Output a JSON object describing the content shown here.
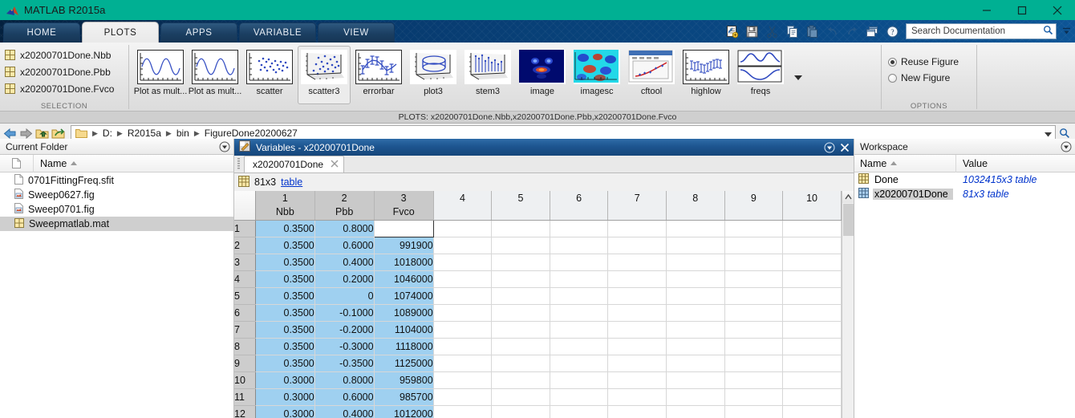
{
  "window": {
    "title": "MATLAB R2015a"
  },
  "tabs": [
    {
      "label": "HOME",
      "active": false
    },
    {
      "label": "PLOTS",
      "active": true
    },
    {
      "label": "APPS",
      "active": false
    },
    {
      "label": "VARIABLE",
      "active": false
    },
    {
      "label": "VIEW",
      "active": false
    }
  ],
  "quickbar": {
    "icons": [
      "new-script-icon",
      "save-icon",
      "cut-icon",
      "copy-icon",
      "paste-icon",
      "undo-icon",
      "redo-icon",
      "layout-icon",
      "help-icon"
    ],
    "search": {
      "placeholder": "Search Documentation",
      "value": ""
    },
    "collapse": "collapse-ribbon-icon"
  },
  "ribbon": {
    "selection": {
      "label": "SELECTION",
      "items": [
        {
          "label": "x20200701Done.Nbb",
          "icon": "table-variable-icon"
        },
        {
          "label": "x20200701Done.Pbb",
          "icon": "table-variable-icon"
        },
        {
          "label": "x20200701Done.Fvco",
          "icon": "table-variable-icon"
        }
      ]
    },
    "gallery": {
      "items": [
        {
          "label": "Plot as mult...",
          "kind": "sine",
          "selected": false
        },
        {
          "label": "Plot as mult...",
          "kind": "sine",
          "selected": false
        },
        {
          "label": "scatter",
          "kind": "scatter",
          "selected": false
        },
        {
          "label": "scatter3",
          "kind": "scatter3",
          "selected": true
        },
        {
          "label": "errorbar",
          "kind": "errorbar",
          "selected": false
        },
        {
          "label": "plot3",
          "kind": "plot3",
          "selected": false
        },
        {
          "label": "stem3",
          "kind": "stem3",
          "selected": false
        },
        {
          "label": "image",
          "kind": "image",
          "selected": false
        },
        {
          "label": "imagesc",
          "kind": "imagesc",
          "selected": false
        },
        {
          "label": "cftool",
          "kind": "cftool",
          "selected": false
        },
        {
          "label": "highlow",
          "kind": "highlow",
          "selected": false
        },
        {
          "label": "freqs",
          "kind": "freqs",
          "selected": false
        }
      ],
      "more": "gallery-more-icon"
    },
    "options": {
      "label": "OPTIONS",
      "choices": [
        {
          "label": "Reuse Figure",
          "selected": true
        },
        {
          "label": "New Figure",
          "selected": false
        }
      ]
    },
    "status": "PLOTS: x20200701Done.Nbb,x20200701Done.Pbb,x20200701Done.Fvco"
  },
  "address": {
    "nav": [
      "back-icon",
      "forward-icon",
      "up-folder-icon",
      "browse-folder-icon"
    ],
    "crumbs": [
      "D:",
      "R2015a",
      "bin",
      "FigureDone20200627"
    ],
    "dropdown": "chevron-down-icon",
    "search": "search-icon"
  },
  "current_folder": {
    "title": "Current Folder",
    "menu": "panel-menu-icon",
    "columns": [
      "",
      "Name"
    ],
    "sort": "ascending",
    "files": [
      {
        "name": "0701FittingFreq.sfit",
        "icon": "file-icon",
        "selected": false
      },
      {
        "name": "Sweep0627.fig",
        "icon": "figure-icon",
        "selected": false
      },
      {
        "name": "Sweep0701.fig",
        "icon": "figure-icon",
        "selected": false
      },
      {
        "name": "Sweepmatlab.mat",
        "icon": "mat-file-icon",
        "selected": true
      }
    ]
  },
  "variables": {
    "title": "Variables - x20200701Done",
    "title_icon": "variables-icon",
    "menu": "panel-menu-icon",
    "close": "close-icon",
    "tab": {
      "label": "x20200701Done",
      "close": "tab-close-icon"
    },
    "info": {
      "icon": "table-icon",
      "size": "81x3",
      "type": "table"
    },
    "table": {
      "col_numbers": [
        "1",
        "2",
        "3",
        "4",
        "5",
        "6",
        "7",
        "8",
        "9",
        "10"
      ],
      "col_names": [
        "Nbb",
        "Pbb",
        "Fvco",
        "",
        "",
        "",
        "",
        "",
        "",
        ""
      ],
      "rows": [
        {
          "n": "1",
          "cells": [
            "0.3500",
            "0.8000",
            ""
          ]
        },
        {
          "n": "2",
          "cells": [
            "0.3500",
            "0.6000",
            "991900"
          ]
        },
        {
          "n": "3",
          "cells": [
            "0.3500",
            "0.4000",
            "1018000"
          ]
        },
        {
          "n": "4",
          "cells": [
            "0.3500",
            "0.2000",
            "1046000"
          ]
        },
        {
          "n": "5",
          "cells": [
            "0.3500",
            "0",
            "1074000"
          ]
        },
        {
          "n": "6",
          "cells": [
            "0.3500",
            "-0.1000",
            "1089000"
          ]
        },
        {
          "n": "7",
          "cells": [
            "0.3500",
            "-0.2000",
            "1104000"
          ]
        },
        {
          "n": "8",
          "cells": [
            "0.3500",
            "-0.3000",
            "1118000"
          ]
        },
        {
          "n": "9",
          "cells": [
            "0.3500",
            "-0.3500",
            "1125000"
          ]
        },
        {
          "n": "10",
          "cells": [
            "0.3000",
            "0.8000",
            "959800"
          ]
        },
        {
          "n": "11",
          "cells": [
            "0.3000",
            "0.6000",
            "985700"
          ]
        },
        {
          "n": "12",
          "cells": [
            "0.3000",
            "0.4000",
            "1012000"
          ]
        }
      ],
      "editing_cell": {
        "row": 1,
        "col": 3
      }
    },
    "scrollbar": {
      "up": "scroll-up-icon"
    }
  },
  "workspace": {
    "title": "Workspace",
    "menu": "panel-menu-icon",
    "columns": [
      "Name",
      "Value"
    ],
    "sort": "ascending",
    "rows": [
      {
        "name": "Done",
        "value": "1032415x3 table",
        "icon": "table-variable-icon",
        "selected": false
      },
      {
        "name": "x20200701Done",
        "value": "81x3 table",
        "icon": "table-variable-blue-icon",
        "selected": true
      }
    ]
  },
  "colors": {
    "titlebar": "#00b093",
    "ribbon_tabs": "#04305f",
    "panel_title": "#1d5590",
    "cell_selected": "#9fd0f0",
    "link": "#0033cc"
  }
}
